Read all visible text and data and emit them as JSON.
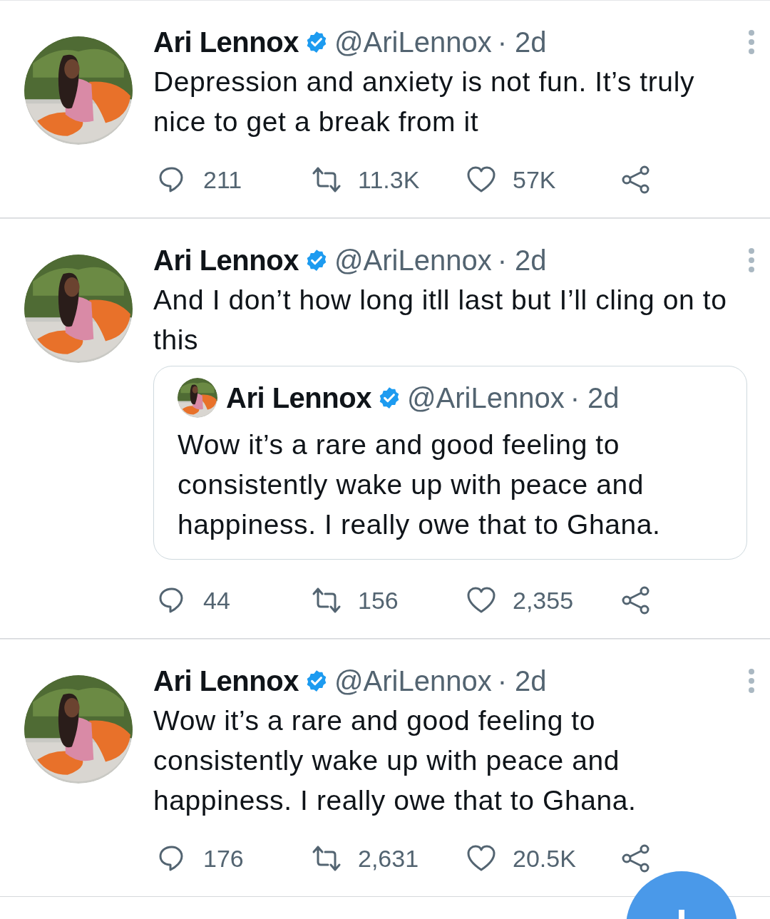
{
  "tweets": [
    {
      "author": "Ari Lennox",
      "verified": true,
      "handle": "@AriLennox",
      "time": "· 2d",
      "text": "Depression and anxiety is not fun. It’s truly nice to get a break from it",
      "stats": {
        "replies": "211",
        "retweets": "11.3K",
        "likes": "57K"
      }
    },
    {
      "author": "Ari Lennox",
      "verified": true,
      "handle": "@AriLennox",
      "time": "· 2d",
      "text": "And I don’t how long itll last but I’ll cling on to this",
      "quote": {
        "author": "Ari Lennox",
        "verified": true,
        "handle": "@AriLennox",
        "time": "· 2d",
        "text": "Wow it’s a rare and good feeling to consistently wake up with peace and happiness. I really owe that to Ghana."
      },
      "stats": {
        "replies": "44",
        "retweets": "156",
        "likes": "2,355"
      }
    },
    {
      "author": "Ari Lennox",
      "verified": true,
      "handle": "@AriLennox",
      "time": "· 2d",
      "text": "Wow it’s a rare and good feeling to consistently wake up with peace and happiness. I really owe that to Ghana.",
      "stats": {
        "replies": "176",
        "retweets": "2,631",
        "likes": "20.5K"
      }
    }
  ],
  "compose_button": {
    "kind": "floating"
  }
}
